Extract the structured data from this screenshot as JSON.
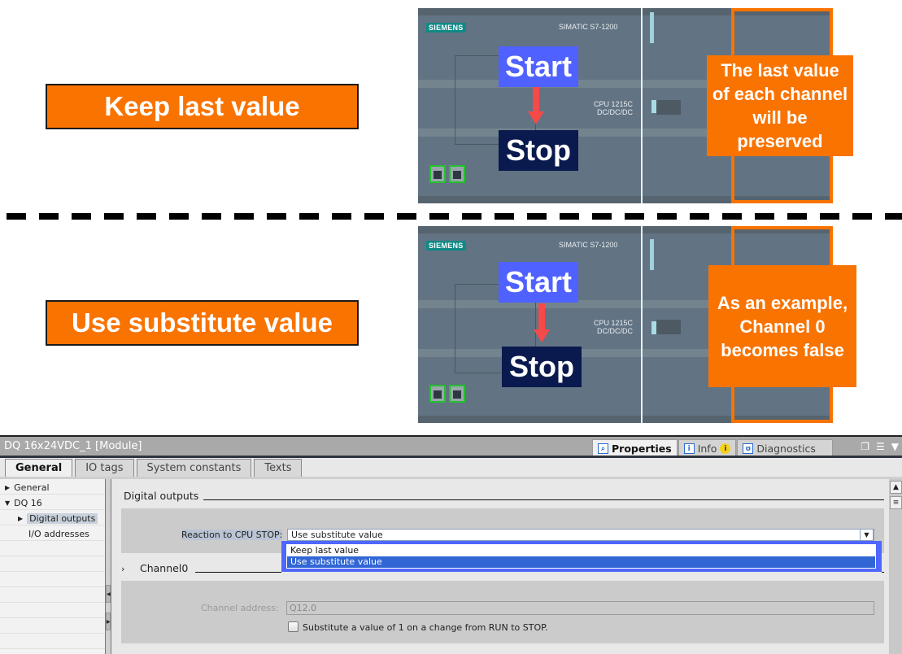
{
  "slide": {
    "top_label": "Keep  last value",
    "bottom_label": "Use substitute value",
    "plc": {
      "brand": "SIEMENS",
      "model": "SIMATIC S7-1200",
      "cpu_line1": "CPU 1215C",
      "cpu_line2": "DC/DC/DC"
    },
    "start_label": "Start",
    "stop_label": "Stop",
    "top_note": "The last value of each channel will be preserved",
    "bottom_note": "As an example, Channel 0 becomes false",
    "colors": {
      "orange": "#f97300",
      "start_blue": "#4f61ff",
      "stop_navy": "#0a1a4e",
      "arrow_red": "#f44a4a"
    }
  },
  "panel": {
    "title": "DQ 16x24VDC_1 [Module]",
    "right_tabs": [
      {
        "label": "Properties",
        "icon": "properties-icon",
        "active": true
      },
      {
        "label": "Info",
        "icon": "info-icon",
        "badge": "i"
      },
      {
        "label": "Diagnostics",
        "icon": "diagnostics-icon"
      }
    ],
    "window_controls": [
      "restore-icon",
      "list-icon",
      "chevron-down-icon"
    ],
    "tabs": [
      {
        "label": "General",
        "active": true
      },
      {
        "label": "IO tags"
      },
      {
        "label": "System constants"
      },
      {
        "label": "Texts"
      }
    ],
    "tree": [
      {
        "label": "General",
        "expander": "▶"
      },
      {
        "label": "DQ 16",
        "expander": "▼"
      },
      {
        "label": "Digital outputs",
        "expander": "▶",
        "selected": true
      },
      {
        "label": "I/O addresses"
      }
    ],
    "section_title": "Digital outputs",
    "reaction_label": "Reaction to CPU STOP:",
    "reaction_value": "Use substitute value",
    "reaction_options": [
      "Keep last value",
      "Use substitute value"
    ],
    "highlighted_option": "Use substitute value",
    "channel_title": "Channel0",
    "channel_expander": "›",
    "channel_address_label": "Channel address:",
    "channel_address_value": "Q12.0",
    "substitute_checkbox_label": "Substitute a value of 1 on a change from RUN to STOP.",
    "substitute_checked": false
  }
}
